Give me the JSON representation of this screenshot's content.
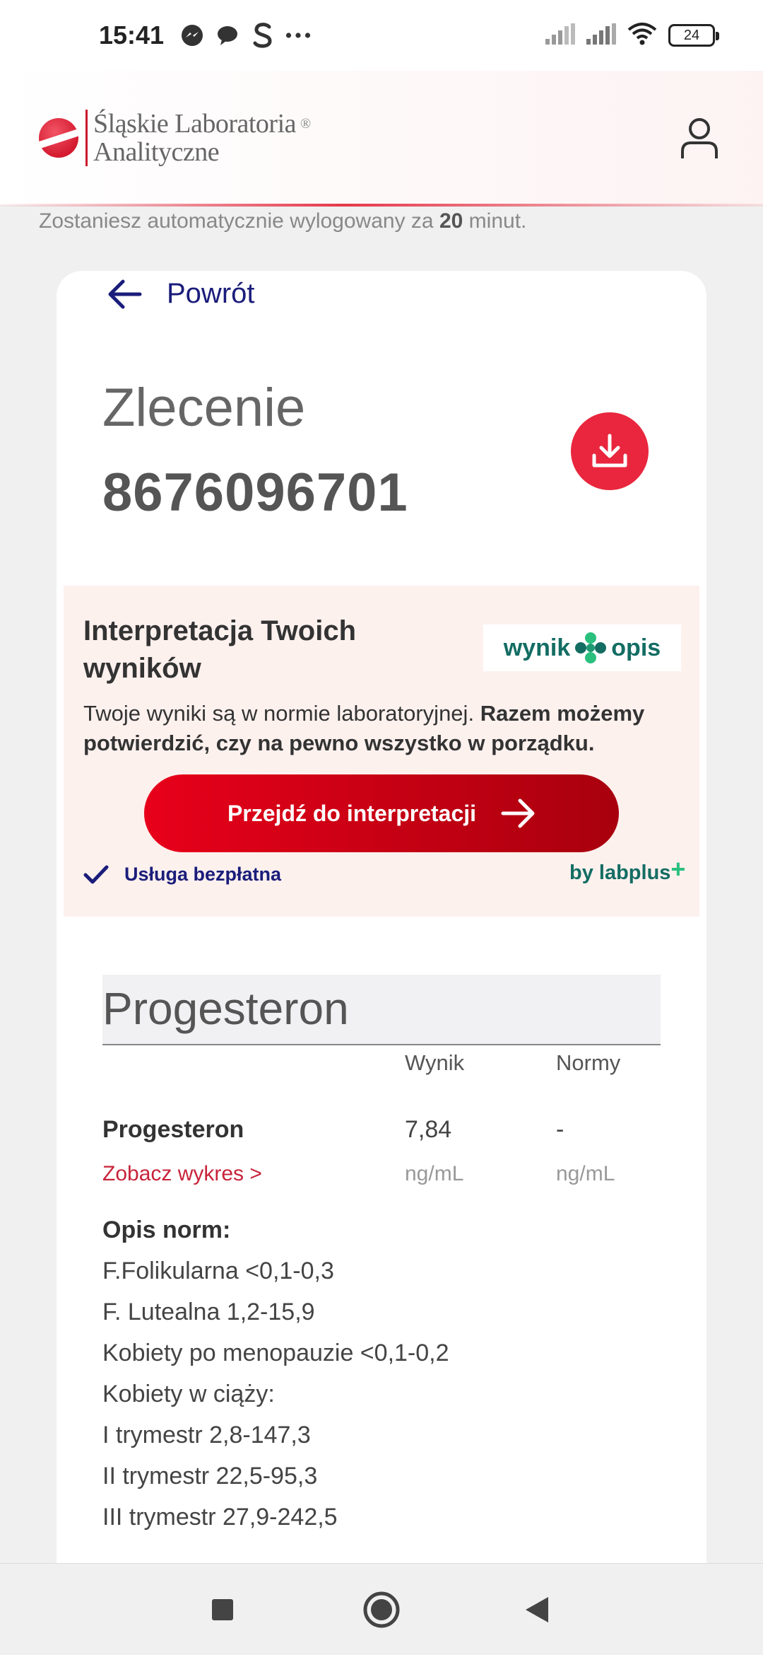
{
  "status_bar": {
    "time": "15:41",
    "battery": "24"
  },
  "header": {
    "logo_line1": "Śląskie Laboratoria",
    "logo_line2": "Analityczne",
    "logo_reg": "®"
  },
  "session": {
    "prefix": "Zostaniesz automatycznie wylogowany za",
    "minutes": "20",
    "suffix": "minut."
  },
  "order": {
    "back_label": "Powrót",
    "label": "Zlecenie",
    "number": "8676096701"
  },
  "interpretation": {
    "title": "Interpretacja Twoich wyników",
    "logo_left": "wynik",
    "logo_right": "opis",
    "text_normal": "Twoje wyniki są w normie laboratoryjnej.",
    "text_bold": "Razem możemy potwierdzić, czy na pewno wszystko w porządku.",
    "button_label": "Przejdź do interpretacji",
    "free_label": "Usługa bezpłatna",
    "by_label": "by labplus",
    "by_plus": "+"
  },
  "results": {
    "section_title": "Progesteron",
    "col_result": "Wynik",
    "col_norms": "Normy",
    "row": {
      "name": "Progesteron",
      "value": "7,84",
      "norm": "-",
      "chart_link": "Zobacz wykres >",
      "unit_value": "ng/mL",
      "unit_norm": "ng/mL"
    },
    "norms_heading": "Opis norm:",
    "norms": [
      "F.Folikularna <0,1-0,3",
      "F. Lutealna 1,2-15,9",
      "Kobiety po menopauzie <0,1-0,2",
      "Kobiety w ciąży:",
      "I trymestr 2,8-147,3",
      "II trymestr 22,5-95,3",
      "III trymestr 27,9-242,5"
    ]
  },
  "colors": {
    "brand_red": "#e9263d",
    "navy": "#1a1d7a",
    "teal": "#136d63"
  }
}
